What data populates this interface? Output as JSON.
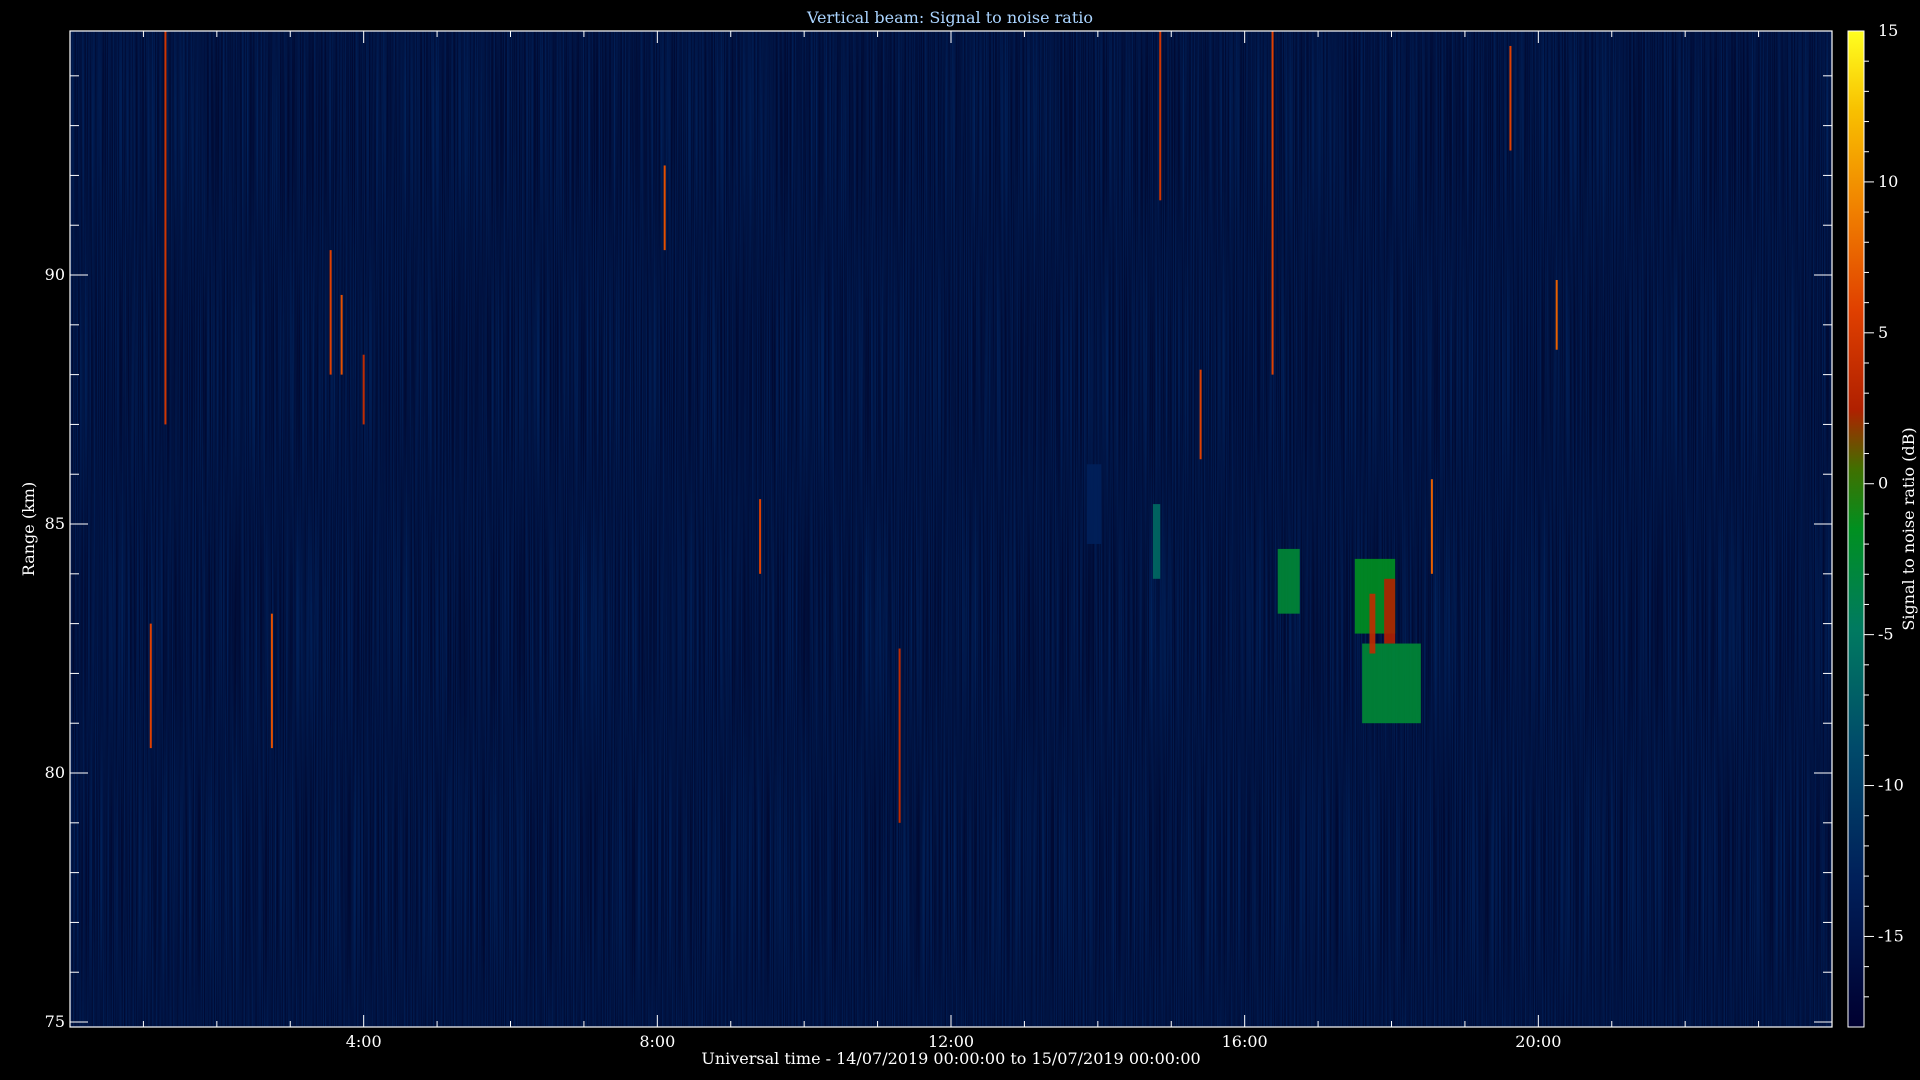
{
  "chart_data": {
    "type": "heatmap",
    "title": "Vertical beam: Signal to noise ratio",
    "xlabel": "Universal time - 14/07/2019 00:00:00 to 15/07/2019 00:00:00",
    "ylabel": "Range (km)",
    "colorbar_label": "Signal to noise ratio (dB)",
    "xlim": [
      0,
      24
    ],
    "ylim": [
      74.9,
      94.9
    ],
    "clim": [
      -18,
      15
    ],
    "x_ticks": [
      {
        "value": 4,
        "label": "4:00"
      },
      {
        "value": 8,
        "label": "8:00"
      },
      {
        "value": 12,
        "label": "12:00"
      },
      {
        "value": 16,
        "label": "16:00"
      },
      {
        "value": 20,
        "label": "20:00"
      }
    ],
    "y_ticks": [
      {
        "value": 75,
        "label": "75"
      },
      {
        "value": 80,
        "label": "80"
      },
      {
        "value": 85,
        "label": "85"
      },
      {
        "value": 90,
        "label": "90"
      }
    ],
    "colorbar_ticks": [
      {
        "value": 15,
        "label": "15"
      },
      {
        "value": 10,
        "label": "10"
      },
      {
        "value": 5,
        "label": "5"
      },
      {
        "value": 0,
        "label": "0"
      },
      {
        "value": -5,
        "label": "-5"
      },
      {
        "value": -10,
        "label": "-10"
      },
      {
        "value": -15,
        "label": "-15"
      }
    ],
    "background_snr_db": -17,
    "echo_regions": [
      {
        "t_start": 16.45,
        "t_end": 16.75,
        "r_min": 83.2,
        "r_max": 84.5,
        "snr_db": -7
      },
      {
        "t_start": 17.5,
        "t_end": 18.05,
        "r_min": 82.8,
        "r_max": 84.3,
        "snr_db": -6
      },
      {
        "t_start": 17.6,
        "t_end": 18.4,
        "r_min": 81.0,
        "r_max": 82.6,
        "snr_db": -7
      },
      {
        "t_start": 17.9,
        "t_end": 18.05,
        "r_min": 82.6,
        "r_max": 83.9,
        "snr_db": 0
      },
      {
        "t_start": 17.7,
        "t_end": 17.78,
        "r_min": 82.4,
        "r_max": 83.6,
        "snr_db": 1
      },
      {
        "t_start": 14.75,
        "t_end": 14.85,
        "r_min": 83.9,
        "r_max": 85.4,
        "snr_db": -10
      },
      {
        "t_start": 13.85,
        "t_end": 14.05,
        "r_min": 84.6,
        "r_max": 86.2,
        "snr_db": -15
      }
    ],
    "streaks": [
      {
        "t": 1.3,
        "r_min": 87.0,
        "r_max": 94.9,
        "snr_db": 2
      },
      {
        "t": 3.55,
        "r_min": 88.0,
        "r_max": 90.5,
        "snr_db": 3
      },
      {
        "t": 4.0,
        "r_min": 87.0,
        "r_max": 88.4,
        "snr_db": 1
      },
      {
        "t": 14.85,
        "r_min": 91.5,
        "r_max": 94.9,
        "snr_db": 2
      },
      {
        "t": 16.38,
        "r_min": 88.0,
        "r_max": 94.9,
        "snr_db": 3
      },
      {
        "t": 19.62,
        "r_min": 92.5,
        "r_max": 94.6,
        "snr_db": 3
      },
      {
        "t": 11.3,
        "r_min": 79.0,
        "r_max": 82.5,
        "snr_db": 1
      },
      {
        "t": 1.1,
        "r_min": 80.5,
        "r_max": 83.0,
        "snr_db": 3
      },
      {
        "t": 2.75,
        "r_min": 80.5,
        "r_max": 83.2,
        "snr_db": 4
      },
      {
        "t": 9.4,
        "r_min": 84.0,
        "r_max": 85.5,
        "snr_db": 3
      },
      {
        "t": 18.55,
        "r_min": 84.0,
        "r_max": 85.9,
        "snr_db": 5
      },
      {
        "t": 20.25,
        "r_min": 88.5,
        "r_max": 89.9,
        "snr_db": 5
      },
      {
        "t": 15.4,
        "r_min": 86.3,
        "r_max": 88.1,
        "snr_db": 3
      },
      {
        "t": 8.1,
        "r_min": 90.5,
        "r_max": 92.2,
        "snr_db": 4
      },
      {
        "t": 3.7,
        "r_min": 88.0,
        "r_max": 89.6,
        "snr_db": 4
      }
    ]
  }
}
